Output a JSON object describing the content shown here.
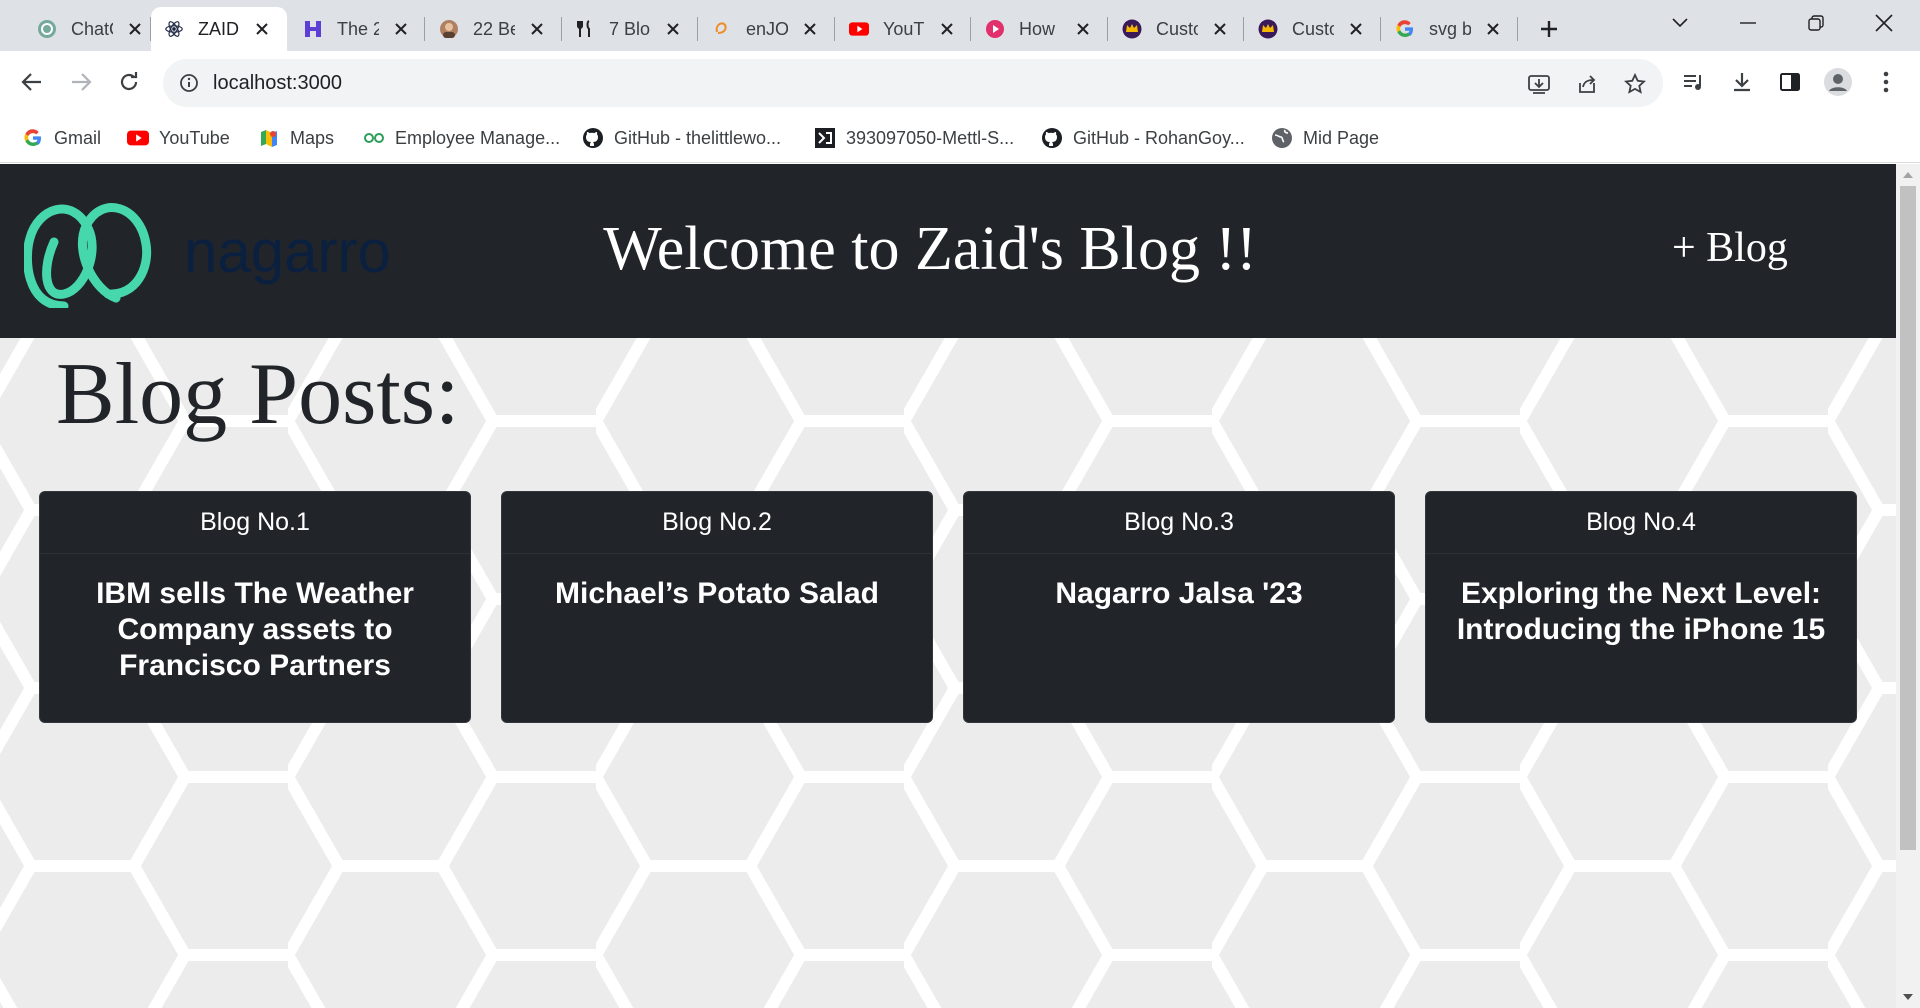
{
  "browser": {
    "tabs": [
      {
        "title": "ChatGPT",
        "favicon": "chatgpt-icon",
        "active": false
      },
      {
        "title": "ZAID",
        "favicon": "react-icon",
        "active": true
      },
      {
        "title": "The 2",
        "favicon": "hashnode-icon",
        "active": false
      },
      {
        "title": "22 Be",
        "favicon": "avatar-icon",
        "active": false
      },
      {
        "title": "7 Blo",
        "favicon": "fork-knife-icon",
        "active": false
      },
      {
        "title": "enJO",
        "favicon": "enjo-icon",
        "active": false
      },
      {
        "title": "YouT",
        "favicon": "youtube-icon",
        "active": false
      },
      {
        "title": "How",
        "favicon": "play-circle-icon",
        "active": false
      },
      {
        "title": "Custo",
        "favicon": "crown-icon",
        "active": false
      },
      {
        "title": "Custo",
        "favicon": "crown-icon",
        "active": false
      },
      {
        "title": "svg b",
        "favicon": "google-icon",
        "active": false
      }
    ],
    "address": {
      "url": "localhost:3000"
    },
    "bookmarks": [
      {
        "label": "Gmail",
        "icon": "google-icon"
      },
      {
        "label": "YouTube",
        "icon": "youtube-icon"
      },
      {
        "label": "Maps",
        "icon": "maps-icon"
      },
      {
        "label": "Employee Manage...",
        "icon": "employee-icon"
      },
      {
        "label": "GitHub - thelittlewo...",
        "icon": "github-icon"
      },
      {
        "label": "393097050-Mettl-S...",
        "icon": "mettl-icon"
      },
      {
        "label": "GitHub - RohanGoy...",
        "icon": "github-icon"
      },
      {
        "label": "Mid Page",
        "icon": "globe-icon"
      }
    ]
  },
  "site": {
    "logo_text": "nagarro",
    "title": "Welcome to Zaid's Blog !!",
    "add_blog": "+ Blog",
    "section_heading": "Blog Posts:"
  },
  "posts": [
    {
      "label": "Blog No.1",
      "title": "IBM sells The Weather Company assets to Francisco Partners"
    },
    {
      "label": "Blog No.2",
      "title": "Michael’s Potato Salad"
    },
    {
      "label": "Blog No.3",
      "title": "Nagarro Jalsa '23"
    },
    {
      "label": "Blog No.4",
      "title": "Exploring the Next Level: Introducing the iPhone 15"
    }
  ],
  "colors": {
    "navbar": "#212529",
    "page_background": "#ececec",
    "hex_lines": "#ffffff",
    "logo_green": "#47d7ac",
    "logo_navy": "#0b1f3f"
  }
}
